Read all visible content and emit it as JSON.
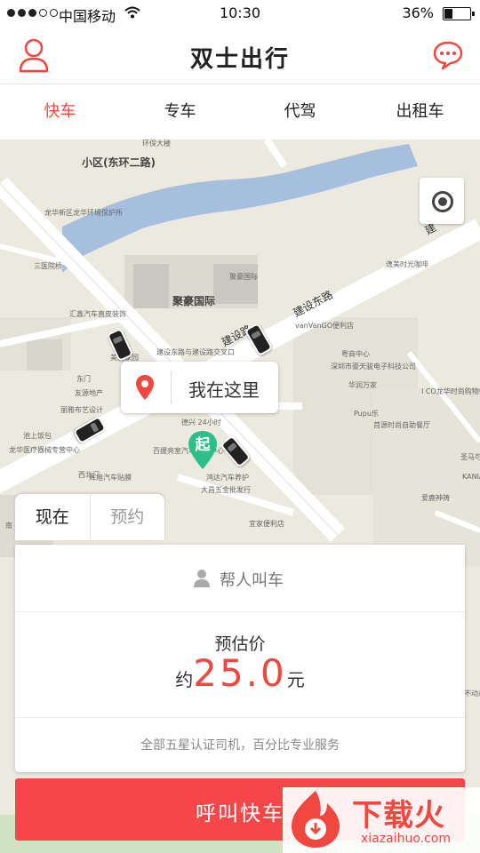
{
  "status_bar": {
    "carrier": "中国移动",
    "time": "10:30",
    "battery": "36%"
  },
  "header": {
    "title": "双士出行"
  },
  "tabs": [
    {
      "label": "快车",
      "active": true
    },
    {
      "label": "专车",
      "active": false
    },
    {
      "label": "代驾",
      "active": false
    },
    {
      "label": "出租车",
      "active": false
    }
  ],
  "map": {
    "here_label": "我在这里",
    "start_marker": "起",
    "labels": {
      "district": "小区(东环二路)",
      "building": "聚豪国际",
      "road": "建设东路",
      "road2": "建设路",
      "l1": "环保大楼",
      "l2": "龙华新区龙华环境保护所",
      "l3": "三医院桥",
      "l4": "汇鑫汽车直皮装饰",
      "l5": "美丽家园",
      "l6": "东门",
      "l7": "友源地产",
      "l8": "丽雅布艺设计",
      "l9": "池上饭包",
      "l10": "龙华医疗器械专营中心",
      "l11": "西北门",
      "l12": "辉旭汽车贴膜",
      "l13": "南",
      "l14": "聚豪国际",
      "l15": "vanVanGO便利店",
      "l16": "逸美时光咖啡",
      "l17": "粤商中心",
      "l18": "深圳市豪天骏电子科技公司",
      "l19": "华润万家",
      "l20": "I CO龙华时尚购物中心",
      "l21": "Pupu乐",
      "l22": "首源时尚自助餐厅",
      "l23": "圣马可",
      "l24": "KANIA尼亚",
      "l25": "爱鹿神祷",
      "l26": "建设东路与建设路交叉口",
      "l27": "德兴 24小时",
      "l28": "百援亮室汽车服务中心",
      "l29": "鸿达汽车养护",
      "l30": "大昌五金批发行",
      "l31": "宜家便利店",
      "l32": "不动产服务",
      "l33": "建"
    }
  },
  "booking": {
    "now_label": "现在",
    "reserve_label": "预约",
    "for_others": "帮人叫车",
    "estimate_label": "预估价",
    "price_prefix": "约",
    "price": "25.0",
    "price_suffix": "元",
    "note": "全部五星认证司机，百分比专业服务",
    "call_button": "呼叫快车"
  },
  "watermark": {
    "name": "下载火",
    "url": "xiazaihuo.com"
  },
  "colors": {
    "accent": "#f0473f",
    "button": "#f5474a",
    "river": "#a6bfde",
    "map_bg": "#ece9df",
    "road": "#ffffff"
  }
}
